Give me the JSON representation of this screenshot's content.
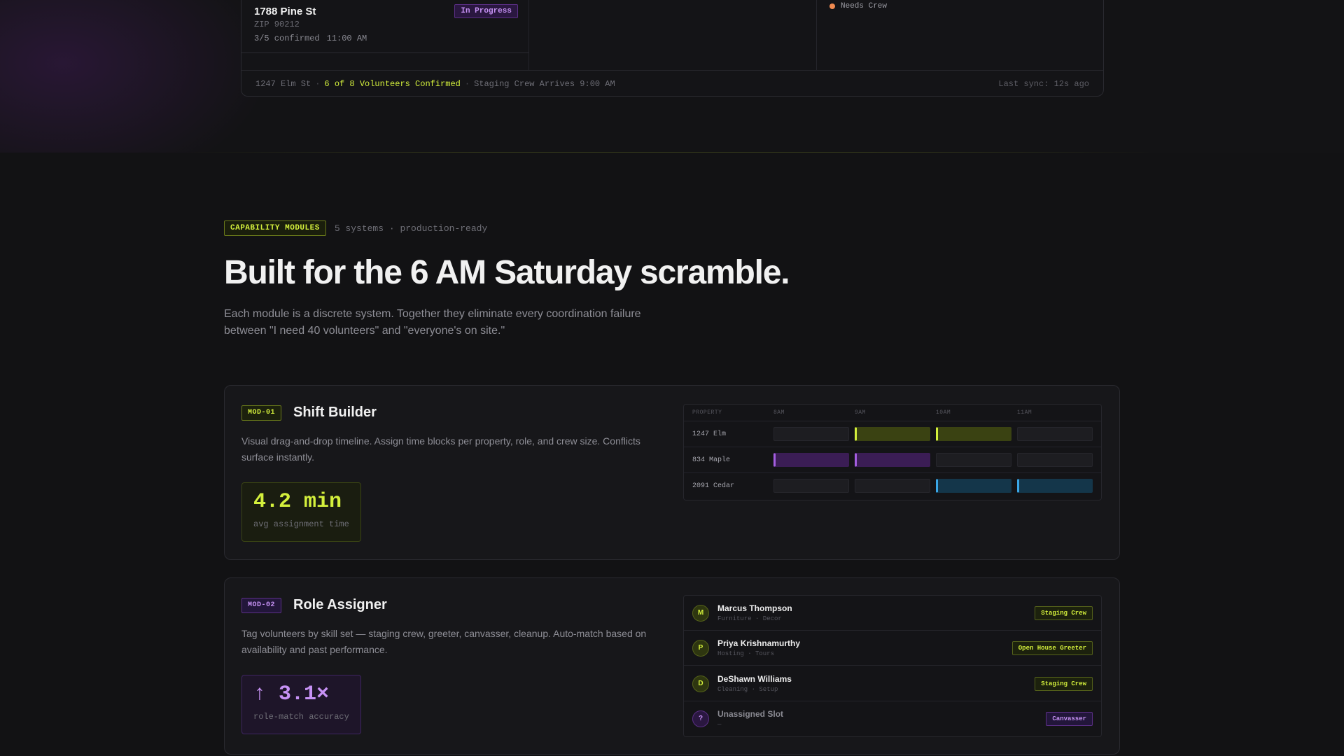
{
  "dashboard": {
    "property": {
      "name": "1788 Pine St",
      "zip": "ZIP 90212",
      "confirmed": "3/5 confirmed",
      "time": "11:00 AM",
      "status": "In Progress"
    },
    "crew_status": "Needs Crew",
    "footer": {
      "address": "1247 Elm St",
      "highlight": "6 of 8 Volunteers Confirmed",
      "arrival": "Staging Crew Arrives 9:00 AM",
      "sync": "Last sync: 12s ago"
    }
  },
  "section": {
    "badge": "CAPABILITY MODULES",
    "subtitle": "5 systems · production-ready",
    "headline": "Built for the 6 AM Saturday scramble.",
    "lead": "Each module is a discrete system. Together they eliminate every coordination failure between \"I need 40 volunteers\" and \"everyone's on site.\""
  },
  "modules": [
    {
      "tag": "MOD-01",
      "title": "Shift Builder",
      "description": "Visual drag-and-drop timeline. Assign time blocks per property, role, and crew size. Conflicts surface instantly.",
      "stat_value": "4.2 min",
      "stat_label": "avg assignment time",
      "schedule": {
        "headers": [
          "PROPERTY",
          "8AM",
          "9AM",
          "10AM",
          "11AM"
        ],
        "rows": [
          {
            "label": "1247 Elm",
            "fills": [
              "",
              "lime",
              "lime",
              ""
            ]
          },
          {
            "label": "834 Maple",
            "fills": [
              "purple",
              "purple",
              "",
              ""
            ]
          },
          {
            "label": "2091 Cedar",
            "fills": [
              "",
              "",
              "blue",
              "blue"
            ]
          }
        ]
      }
    },
    {
      "tag": "MOD-02",
      "title": "Role Assigner",
      "description": "Tag volunteers by skill set — staging crew, greeter, canvasser, cleanup. Auto-match based on availability and past performance.",
      "stat_value": "↑ 3.1×",
      "stat_label": "role-match accuracy",
      "roles": [
        {
          "initial": "M",
          "name": "Marcus Thompson",
          "skills": "Furniture · Decor",
          "role": "Staging Crew",
          "accent": "lime"
        },
        {
          "initial": "P",
          "name": "Priya Krishnamurthy",
          "skills": "Hosting · Tours",
          "role": "Open House Greeter",
          "accent": "lime"
        },
        {
          "initial": "D",
          "name": "DeShawn Williams",
          "skills": "Cleaning · Setup",
          "role": "Staging Crew",
          "accent": "lime"
        },
        {
          "initial": "?",
          "name": "Unassigned Slot",
          "skills": "—",
          "role": "Canvasser",
          "accent": "purple"
        }
      ]
    }
  ],
  "colors": {
    "accent_lime": "#d4f03c",
    "accent_purple": "#c792f5",
    "accent_blue": "#3aa6e6",
    "status_orange": "#f08a50",
    "background": "#121214"
  }
}
